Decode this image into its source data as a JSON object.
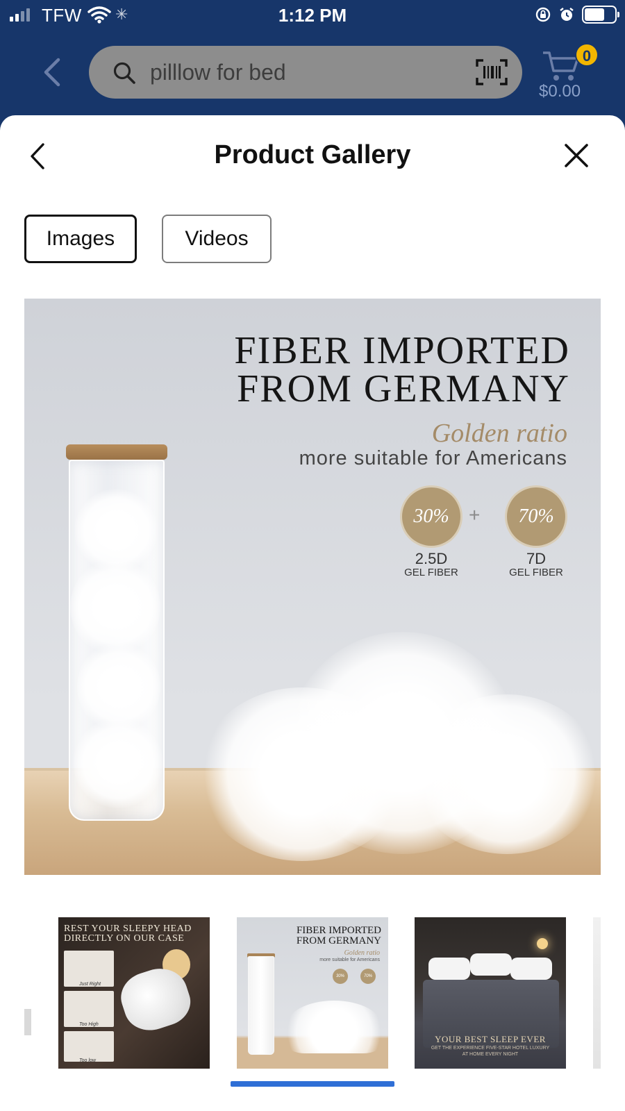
{
  "status_bar": {
    "carrier": "TFW",
    "time": "1:12 PM"
  },
  "header": {
    "search_value": "pilllow for bed",
    "cart_count": "0",
    "cart_total": "$0.00"
  },
  "gallery": {
    "title": "Product Gallery",
    "tabs": [
      {
        "label": "Images",
        "active": true
      },
      {
        "label": "Videos",
        "active": false
      }
    ]
  },
  "main_image": {
    "headline_line1": "FIBER IMPORTED",
    "headline_line2": "FROM GERMANY",
    "golden": "Golden ratio",
    "subtitle": "more suitable for Americans",
    "badge1": "30%",
    "badge2": "70%",
    "plus": "+",
    "fiber1_size": "2.5D",
    "fiber1_label": "GEL FIBER",
    "fiber2_size": "7D",
    "fiber2_label": "GEL FIBER"
  },
  "thumbnails": {
    "selected_index": 1,
    "t1": {
      "title_line1": "REST YOUR SLEEPY HEAD",
      "title_line2": "DIRECTLY ON OUR CASE",
      "cap1": "Just Right",
      "cap2": "Too High",
      "cap3": "Too low"
    },
    "t2": {
      "line1": "FIBER IMPORTED",
      "line2": "FROM GERMANY",
      "gold": "Golden ratio",
      "sub": "more suitable for Americans",
      "b1": "30%",
      "b2": "70%"
    },
    "t3": {
      "title": "YOUR BEST SLEEP EVER",
      "sub1": "GET THE EXPERIENCE FIVE-STAR HOTEL LUXURY",
      "sub2": "AT HOME EVERY NIGHT"
    }
  },
  "colors": {
    "header_bg": "#17366a",
    "accent_gold": "#b19a73",
    "indicator": "#2f6fd6"
  }
}
